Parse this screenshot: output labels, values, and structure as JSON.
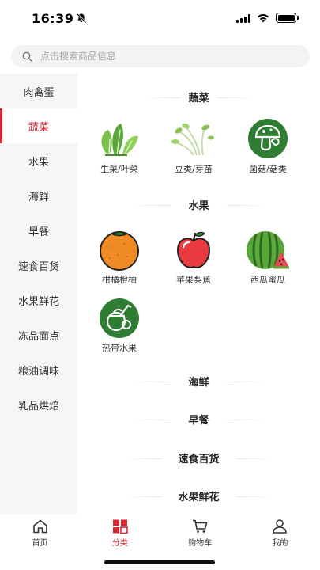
{
  "status": {
    "time": "16:39"
  },
  "search": {
    "placeholder": "点击搜索商品信息"
  },
  "sidebar": {
    "items": [
      {
        "label": "肉禽蛋"
      },
      {
        "label": "蔬菜",
        "active": true
      },
      {
        "label": "水果"
      },
      {
        "label": "海鲜"
      },
      {
        "label": "早餐"
      },
      {
        "label": "速食百货"
      },
      {
        "label": "水果鲜花"
      },
      {
        "label": "冻品面点"
      },
      {
        "label": "粮油调味"
      },
      {
        "label": "乳品烘焙"
      }
    ]
  },
  "content": {
    "sections": [
      {
        "title": "蔬菜",
        "items": [
          {
            "label": "生菜/叶菜",
            "icon": "leafy-greens-icon"
          },
          {
            "label": "豆类/芽苗",
            "icon": "bean-sprouts-icon"
          },
          {
            "label": "菌菇/菇类",
            "icon": "mushroom-icon"
          }
        ]
      },
      {
        "title": "水果",
        "items": [
          {
            "label": "柑橘橙柚",
            "icon": "orange-icon"
          },
          {
            "label": "苹果梨蕉",
            "icon": "apple-icon"
          },
          {
            "label": "西瓜蜜瓜",
            "icon": "watermelon-icon"
          },
          {
            "label": "热带水果",
            "icon": "coconut-icon"
          }
        ]
      },
      {
        "title": "海鲜",
        "items": []
      },
      {
        "title": "早餐",
        "items": []
      },
      {
        "title": "速食百货",
        "items": []
      },
      {
        "title": "水果鲜花",
        "items": []
      }
    ]
  },
  "tabbar": {
    "items": [
      {
        "label": "首页",
        "icon": "home-icon"
      },
      {
        "label": "分类",
        "icon": "category-icon",
        "active": true
      },
      {
        "label": "购物车",
        "icon": "cart-icon"
      },
      {
        "label": "我的",
        "icon": "user-icon"
      }
    ]
  },
  "colors": {
    "accent": "#d8272d",
    "green": "#2e7d32"
  }
}
